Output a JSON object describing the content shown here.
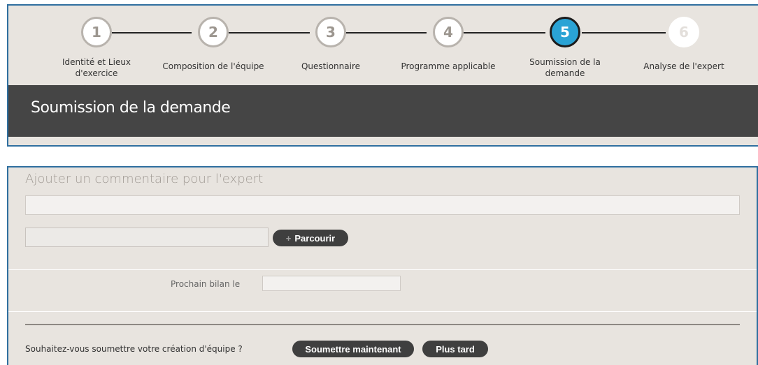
{
  "stepper": {
    "steps": [
      {
        "number": "1",
        "label_line1": "Identité et Lieux",
        "label_line2": "d'exercice"
      },
      {
        "number": "2",
        "label_line1": "Composition de l'équipe",
        "label_line2": ""
      },
      {
        "number": "3",
        "label_line1": "Questionnaire",
        "label_line2": ""
      },
      {
        "number": "4",
        "label_line1": "Programme applicable",
        "label_line2": ""
      },
      {
        "number": "5",
        "label_line1": "Soumission de la",
        "label_line2": "demande"
      },
      {
        "number": "6",
        "label_line1": "Analyse de l'expert",
        "label_line2": ""
      }
    ],
    "active_step": 5
  },
  "header": {
    "title": "Soumission de la demande"
  },
  "form": {
    "comment_label": "Ajouter un commentaire pour l'expert",
    "comment_value": "",
    "file_value": "",
    "browse_label": "Parcourir",
    "next_review_label": "Prochain bilan le",
    "next_review_value": "",
    "submit_question": "Souhaitez-vous soumettre votre création d'équipe ?",
    "submit_now_label": "Soumettre maintenant",
    "later_label": "Plus tard"
  },
  "colors": {
    "active_step": "#2aa3d5",
    "header_bar": "#454545",
    "panel_bg": "#e8e4df",
    "button_bg": "#3f3f3f"
  }
}
